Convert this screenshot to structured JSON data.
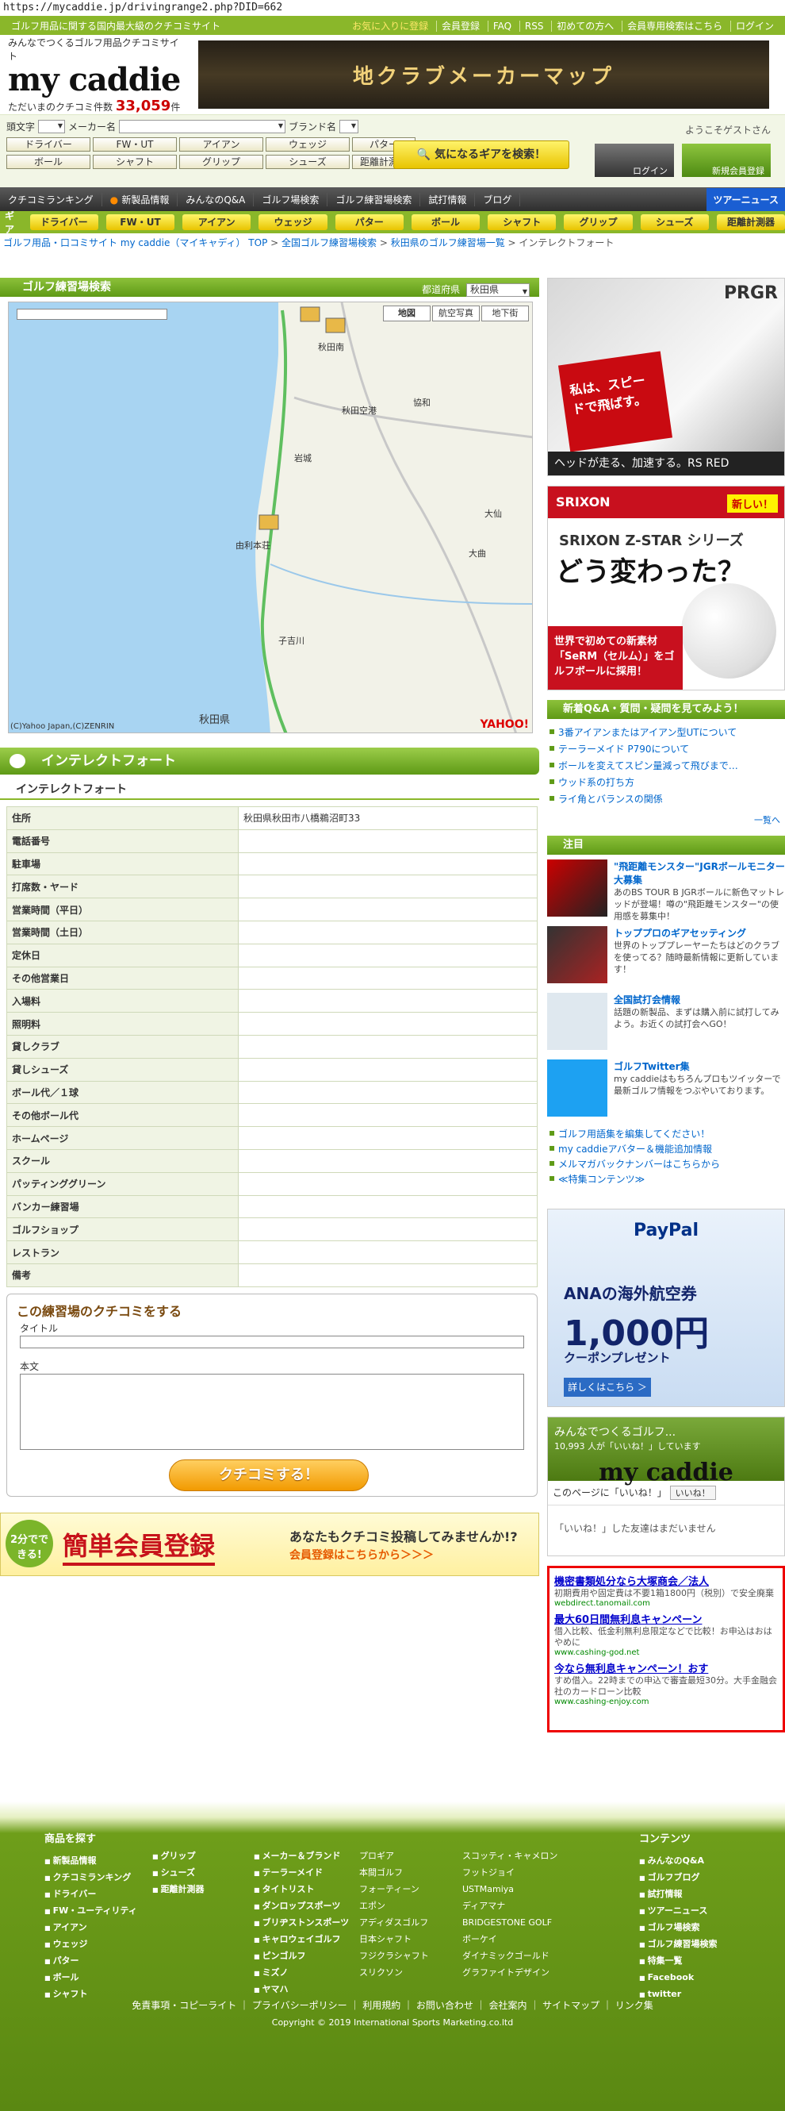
{
  "url": "https://mycaddie.jp/drivingrange2.php?DID=662",
  "topbar": {
    "tagline": "ゴルフ用品に関する国内最大級のクチコミサイト",
    "links": [
      "お気に入りに登録",
      "会員登録",
      "FAQ",
      "RSS",
      "初めての方へ",
      "会員専用検索はこちら",
      "ログイン"
    ]
  },
  "header": {
    "logo_tagline": "みんなでつくるゴルフ用品クチコミサイト",
    "logo_name": "my caddie",
    "count_label": "ただいまのクチコミ件数",
    "count_value": "33,059",
    "count_unit": "件",
    "banner_text": "地クラブメーカーマップ"
  },
  "search": {
    "initial_label": "頭文字",
    "maker_label": "メーカー名",
    "brand_label": "ブランド名",
    "row1": [
      "ドライバー",
      "FW・UT",
      "アイアン",
      "ウェッジ",
      "パター"
    ],
    "row2": [
      "ボール",
      "シャフト",
      "グリップ",
      "シューズ",
      "距離計測器"
    ],
    "gear_button": "気になるギアを検索！",
    "welcome": "ようこそゲストさん",
    "login": "ログイン",
    "register": "新規会員登録"
  },
  "nav1": [
    "クチコミランキング",
    "新製品情報",
    "みんなのQ&A",
    "ゴルフ場検索",
    "ゴルフ練習場検索",
    "試打情報",
    "ブログ"
  ],
  "nav1_tour": "ツアーニュース",
  "nav2_label": "ギア",
  "nav2": [
    "ドライバー",
    "FW・UT",
    "アイアン",
    "ウェッジ",
    "パター",
    "ボール",
    "シャフト",
    "グリップ",
    "シューズ",
    "距離計測器"
  ],
  "breadcrumb": [
    "ゴルフ用品・口コミサイト my caddie（マイキャディ） TOP",
    "全国ゴルフ練習場検索",
    "秋田県のゴルフ練習場一覧",
    "インテレクトフォート"
  ],
  "range_search": {
    "title": "ゴルフ練習場検索",
    "pref_label": "都道府県",
    "pref_value": "秋田県",
    "map_tabs": [
      "地図",
      "航空写真",
      "地下街"
    ],
    "map_copyright": "(C)Yahoo Japan,(C)ZENRIN",
    "map_logo": "YAHOO!",
    "map_places": [
      "秋田南",
      "秋田空港",
      "協和",
      "岩城",
      "大仙",
      "大曲",
      "由利本荘",
      "子吉川",
      "秋田県"
    ]
  },
  "place": {
    "name": "インテレクトフォート",
    "sub": "インテレクトフォート",
    "rows": [
      {
        "k": "住所",
        "v": "秋田県秋田市八橋鵜沼町33"
      },
      {
        "k": "電話番号",
        "v": ""
      },
      {
        "k": "駐車場",
        "v": ""
      },
      {
        "k": "打席数・ヤード",
        "v": ""
      },
      {
        "k": "営業時間（平日）",
        "v": ""
      },
      {
        "k": "営業時間（土日）",
        "v": ""
      },
      {
        "k": "定休日",
        "v": ""
      },
      {
        "k": "その他営業日",
        "v": ""
      },
      {
        "k": "入場料",
        "v": ""
      },
      {
        "k": "照明料",
        "v": ""
      },
      {
        "k": "貸しクラブ",
        "v": ""
      },
      {
        "k": "貸しシューズ",
        "v": ""
      },
      {
        "k": "ボール代／１球",
        "v": ""
      },
      {
        "k": "その他ボール代",
        "v": ""
      },
      {
        "k": "ホームページ",
        "v": ""
      },
      {
        "k": "スクール",
        "v": ""
      },
      {
        "k": "パッティンググリーン",
        "v": ""
      },
      {
        "k": "バンカー練習場",
        "v": ""
      },
      {
        "k": "ゴルフショップ",
        "v": ""
      },
      {
        "k": "レストラン",
        "v": ""
      },
      {
        "k": "備考",
        "v": ""
      }
    ]
  },
  "review": {
    "heading": "この練習場のクチコミをする",
    "title_label": "タイトル",
    "body_label": "本文",
    "submit": "クチコミする！"
  },
  "register_banner": {
    "badge": "2分でできる!",
    "title": "簡単会員登録",
    "question": "あなたもクチコミ投稿してみませんか!?",
    "cta": "会員登録はこちらから＞＞＞"
  },
  "ads": {
    "prgr_brand": "PRGR",
    "prgr_copy": "私は、スピードで飛ばす。",
    "prgr_footer": "ヘッドが走る、加速する。RS RED",
    "srixon_brand": "SRIXON",
    "srixon_new": "新しい！",
    "srixon_h1": "SRIXON Z-STAR シリーズ",
    "srixon_h2": "どう変わった？",
    "srixon_sub": "世界で初めての新素材「SeRM（セルム）」をゴルフボールに採用！",
    "paypal_brand": "PayPal",
    "paypal_a": "ANAの海外航空券",
    "paypal_n": "1,000円",
    "paypal_cp": "クーポンプレゼント",
    "paypal_d": "詳しくはこちら ＞"
  },
  "qa": {
    "title": "新着Q&A・質問・疑問を見てみよう！",
    "items": [
      "3番アイアンまたはアイアン型UTについて",
      "テーラーメイド P790について",
      "ボールを変えてスピン量減って飛びまで…",
      "ウッド系の打ち方",
      "ライ角とバランスの関係"
    ],
    "more": "一覧へ"
  },
  "featured": {
    "title": "注目",
    "items": [
      {
        "t": "\"飛距離モンスター\"JGRボールモニター大募集",
        "d": "あのBS TOUR B JGRボールに新色マットレッドが登場！噂の\"飛距離モンスター\"の使用感を募集中！"
      },
      {
        "t": "トッププロのギアセッティング",
        "d": "世界のトッププレーヤーたちはどのクラブを使ってる？随時最新情報に更新しています！"
      },
      {
        "t": "全国試打会情報",
        "d": "話題の新製品、まずは購入前に試打してみよう。お近くの試打会へGO！"
      },
      {
        "t": "ゴルフTwitter集",
        "d": "my caddieはもちろんプロもツイッターで最新ゴルフ情報をつぶやいております。"
      }
    ],
    "links": [
      "ゴルフ用語集を編集してください！",
      "my caddieアバター＆機能追加情報",
      "メルマガバックナンバーはこちらから",
      "≪特集コンテンツ≫"
    ]
  },
  "fb": {
    "title": "みんなでつくるゴルフ...",
    "likes": "10,993 人が「いいね！」しています",
    "logo": "my caddie",
    "bar": "このページに「いいね！」",
    "like_btn": "いいね！",
    "msg": "「いいね！」した友達はまだいません"
  },
  "textads": [
    {
      "a": "機密書類処分なら大塚商会／法人",
      "b": "初期費用や固定費は不要1箱1800円（税別）で安全廃棄",
      "u": "webdirect.tanomail.com"
    },
    {
      "a": "最大60日間無利息キャンペーン",
      "b": "借入比較、低金利無利息限定などで比較！お申込はおはやめに",
      "u": "www.cashing-god.net"
    },
    {
      "a": "今なら無利息キャンペーン！おす",
      "b": "すめ借入。22時までの申込で審査最短30分。大手金融会社のカードローン比較",
      "u": "www.cashing-enjoy.com"
    }
  ],
  "footer": {
    "products_title": "商品を探す",
    "col1": [
      "新製品情報",
      "クチコミランキング",
      "ドライバー",
      "FW・ユーティリティ",
      "アイアン",
      "ウェッジ",
      "パター",
      "ボール",
      "シャフト"
    ],
    "col2": [
      "グリップ",
      "シューズ",
      "距離計測器"
    ],
    "col3": [
      "メーカー＆ブランド",
      "テーラーメイド",
      "タイトリスト",
      "ダンロップスポーツ",
      "ブリヂストンスポーツ",
      "キャロウェイゴルフ",
      "ピンゴルフ",
      "ミズノ",
      "ヤマハ"
    ],
    "col4": [
      "プロギア",
      "本間ゴルフ",
      "フォーティーン",
      "エポン",
      "アディダスゴルフ",
      "日本シャフト",
      "フジクラシャフト",
      "スリクソン"
    ],
    "col5": [
      "スコッティ・キャメロン",
      "フットジョイ",
      "USTMamiya",
      "ディアマナ",
      "BRIDGESTONE GOLF",
      "ボーケイ",
      "ダイナミックゴールド",
      "グラファイトデザイン"
    ],
    "contents_title": "コンテンツ",
    "col6": [
      "みんなのQ&A",
      "ゴルフブログ",
      "試打情報",
      "ツアーニュース",
      "ゴルフ場検索",
      "ゴルフ練習場検索",
      "特集一覧",
      "Facebook",
      "twitter"
    ],
    "nav": "免責事項・コピーライト ｜ プライバシーポリシー ｜ 利用規約 ｜ お問い合わせ ｜ 会社案内 ｜ サイトマップ ｜ リンク集",
    "copyright": "Copyright © 2019 International Sports Marketing.co.ltd"
  }
}
